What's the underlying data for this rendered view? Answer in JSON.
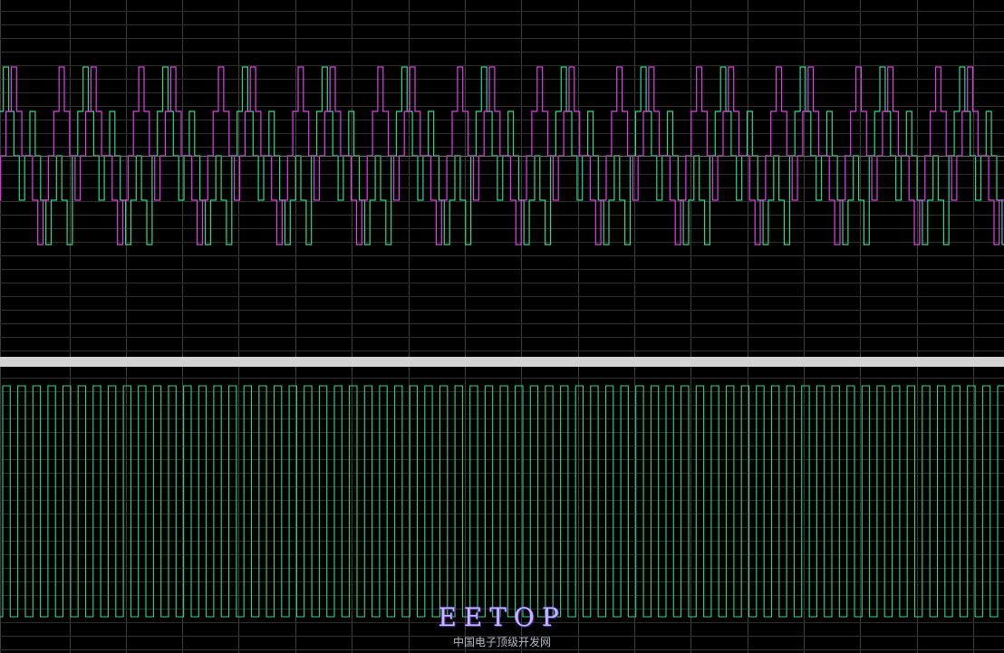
{
  "colors": {
    "background": "#000000",
    "grid": "#2e2e2e",
    "grid_major": "#3c3c3c",
    "separator": "#d4d4d4",
    "trace_green": "#2fd88a",
    "trace_magenta": "#e23fe6"
  },
  "watermark": {
    "logo": "EETOP",
    "subtitle": "中国电子顶级开发网"
  },
  "chart_data": [
    {
      "type": "line",
      "series": [
        {
          "color": "#2fd88a",
          "pattern_levels": [
            0,
            1,
            2,
            1,
            0,
            -1,
            0,
            1,
            0,
            -1,
            -2,
            -1,
            0,
            -1,
            -2
          ],
          "periods": 13
        },
        {
          "color": "#e23fe6",
          "pattern_levels": [
            0,
            -1,
            -2,
            -1,
            0,
            1,
            2,
            1,
            0,
            -1,
            0,
            1,
            2,
            1,
            0
          ],
          "periods": 13
        }
      ],
      "level_scale": [
        -2,
        2
      ],
      "grid": true
    },
    {
      "type": "line",
      "series": [
        {
          "color": "#2fd88a",
          "waveform": "square",
          "cycles": 67,
          "values_high_low": [
            1,
            0
          ]
        }
      ],
      "grid": true
    }
  ]
}
